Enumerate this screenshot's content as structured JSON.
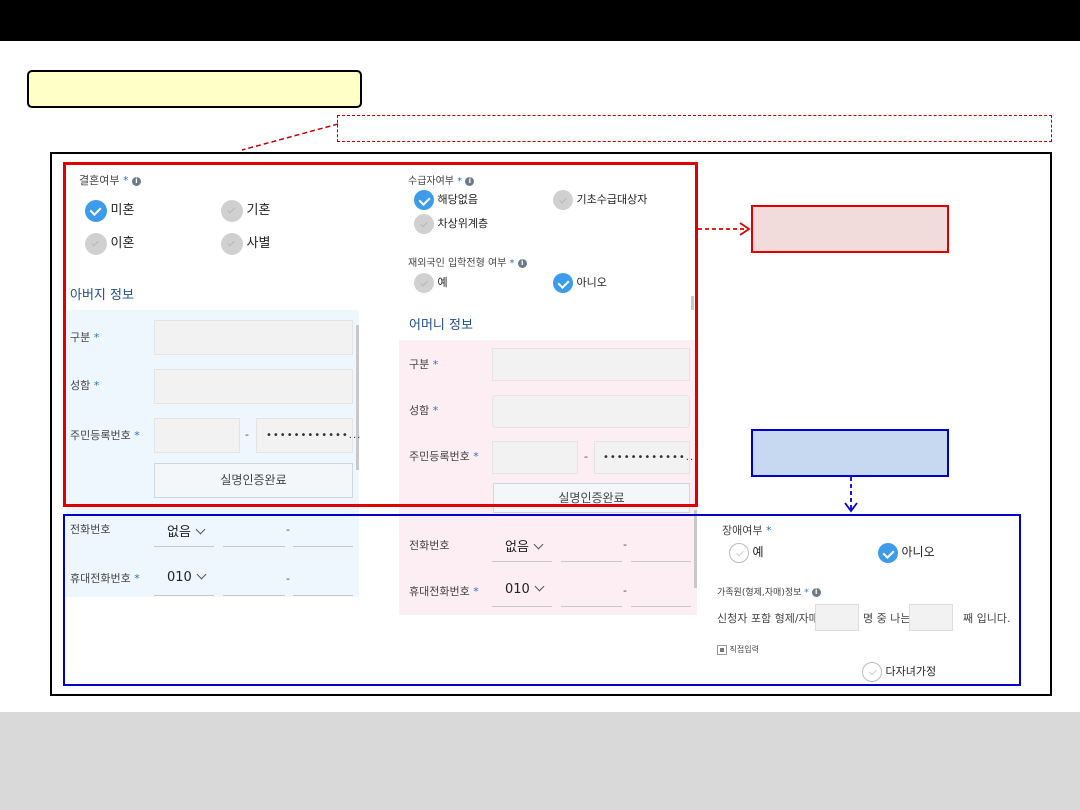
{
  "marriage": {
    "label": "결혼여부",
    "req": "*",
    "options": [
      "미혼",
      "기혼",
      "이혼",
      "사별"
    ],
    "selected": "미혼"
  },
  "welfare": {
    "label": "수급자여부",
    "req": "*",
    "options": [
      "해당없음",
      "기초수급대상자",
      "차상위계층"
    ],
    "selected": "해당없음"
  },
  "overseas": {
    "label": "재외국인 입학전형 여부",
    "req": "*",
    "options": [
      "예",
      "아니오"
    ],
    "selected": "아니오"
  },
  "father": {
    "title": "아버지 정보",
    "type_label": "구분",
    "name_label": "성함",
    "rrn_label": "주민등록번호",
    "rrn_dash": "-",
    "rrn_masked": "••••••••••••...",
    "verify_button": "실명인증완료",
    "phone_label": "전화번호",
    "phone_prefix": "없음",
    "mobile_label": "휴대전화번호",
    "mobile_prefix": "010",
    "dash": "-",
    "req": "*"
  },
  "mother": {
    "title": "어머니 정보",
    "type_label": "구분",
    "name_label": "성함",
    "rrn_label": "주민등록번호",
    "rrn_dash": "-",
    "rrn_masked": "••••••••••••...",
    "verify_button": "실명인증완료",
    "phone_label": "전화번호",
    "phone_prefix": "없음",
    "mobile_label": "휴대전화번호",
    "mobile_prefix": "010",
    "dash": "-",
    "req": "*"
  },
  "disability": {
    "label": "장애여부",
    "req": "*",
    "options": [
      "예",
      "아니오"
    ],
    "selected": "아니오"
  },
  "family": {
    "label": "가족원(형제,자매)정보",
    "req": "*",
    "sentence_a": "신청자 포함 형제/자매",
    "sentence_b": "명 중 나는",
    "sentence_c": "째 입니다.",
    "direct_input": "직접입력",
    "multi_child": "다자녀가정"
  },
  "colors": {
    "accent": "#3d9be9",
    "red_annotation": "#e00000",
    "blue_annotation": "#0000cc",
    "title_fill": "#ffffc8"
  }
}
